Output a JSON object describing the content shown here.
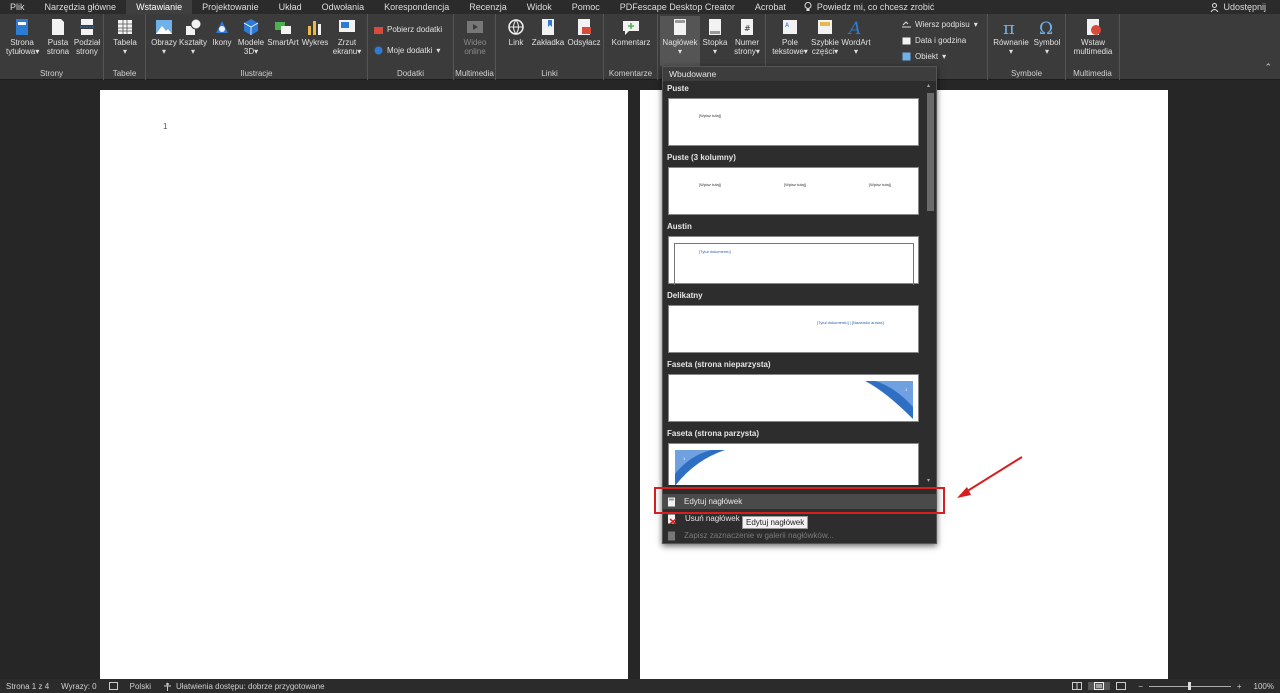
{
  "menu": {
    "tabs": [
      "Plik",
      "Narzędzia główne",
      "Wstawianie",
      "Projektowanie",
      "Układ",
      "Odwołania",
      "Korespondencja",
      "Recenzja",
      "Widok",
      "Pomoc",
      "PDFescape Desktop Creator",
      "Acrobat"
    ],
    "active": "Wstawianie",
    "tell_me": "Powiedz mi, co chcesz zrobić",
    "share": "Udostępnij"
  },
  "ribbon": {
    "strony": {
      "label": "Strony",
      "cover_l1": "Strona",
      "cover_l2": "tytułowa",
      "blank_l1": "Pusta",
      "blank_l2": "strona",
      "break_l1": "Podział",
      "break_l2": "strony"
    },
    "tabele": {
      "label": "Tabele",
      "table": "Tabela"
    },
    "ilustracje": {
      "label": "Ilustracje",
      "pictures": "Obrazy",
      "shapes": "Kształty",
      "icons": "Ikony",
      "models_l1": "Modele",
      "models_l2": "3D",
      "smartart": "SmartArt",
      "chart": "Wykres",
      "screenshot_l1": "Zrzut",
      "screenshot_l2": "ekranu"
    },
    "dodatki": {
      "label": "Dodatki",
      "get": "Pobierz dodatki",
      "my": "Moje dodatki"
    },
    "multimedia": {
      "label": "Multimedia",
      "video_l1": "Wideo",
      "video_l2": "online"
    },
    "linki": {
      "label": "Linki",
      "link": "Link",
      "bookmark": "Zakładka",
      "crossref": "Odsyłacz"
    },
    "komentarze": {
      "label": "Komentarze",
      "comment": "Komentarz"
    },
    "naglowek": {
      "header": "Nagłówek",
      "footer": "Stopka",
      "pagenum_l1": "Numer",
      "pagenum_l2": "strony"
    },
    "tekst": {
      "textbox_l1": "Pole",
      "textbox_l2": "tekstowe",
      "quickparts_l1": "Szybkie",
      "quickparts_l2": "części",
      "wordart": "WordArt",
      "signature": "Wiersz podpisu",
      "datetime": "Data i godzina",
      "object": "Obiekt"
    },
    "symbole": {
      "label": "Symbole",
      "equation": "Równanie",
      "symbol": "Symbol"
    },
    "multimedia2": {
      "label": "Multimedia",
      "insert_l1": "Wstaw",
      "insert_l2": "multimedia"
    }
  },
  "document": {
    "line_number": "1"
  },
  "dropdown": {
    "section": "Wbudowane",
    "gallery": [
      {
        "title": "Puste",
        "placeholders": [
          "[Wpisz tutaj]"
        ]
      },
      {
        "title": "Puste (3 kolumny)",
        "placeholders": [
          "[Wpisz tutaj]",
          "[Wpisz tutaj]",
          "[Wpisz tutaj]"
        ]
      },
      {
        "title": "Austin",
        "placeholders": [
          "[Tytuł dokumentu]"
        ]
      },
      {
        "title": "Delikatny",
        "placeholders": [
          "[Tytuł dokumentu] | [Nazwisko autora]"
        ]
      },
      {
        "title": "Faseta (strona nieparzysta)",
        "placeholders": [
          "1"
        ]
      },
      {
        "title": "Faseta (strona parzysta)",
        "placeholders": [
          "1"
        ]
      }
    ],
    "edit": "Edytuj nagłówek",
    "remove": "Usuń nagłówek",
    "save": "Zapisz zaznaczenie w galerii nagłówków..."
  },
  "tooltip": "Edytuj nagłówek",
  "status": {
    "page": "Strona 1 z 4",
    "words": "Wyrazy: 0",
    "language": "Polski",
    "accessibility": "Ułatwienia dostępu: dobrze przygotowane",
    "zoom": "100%"
  }
}
